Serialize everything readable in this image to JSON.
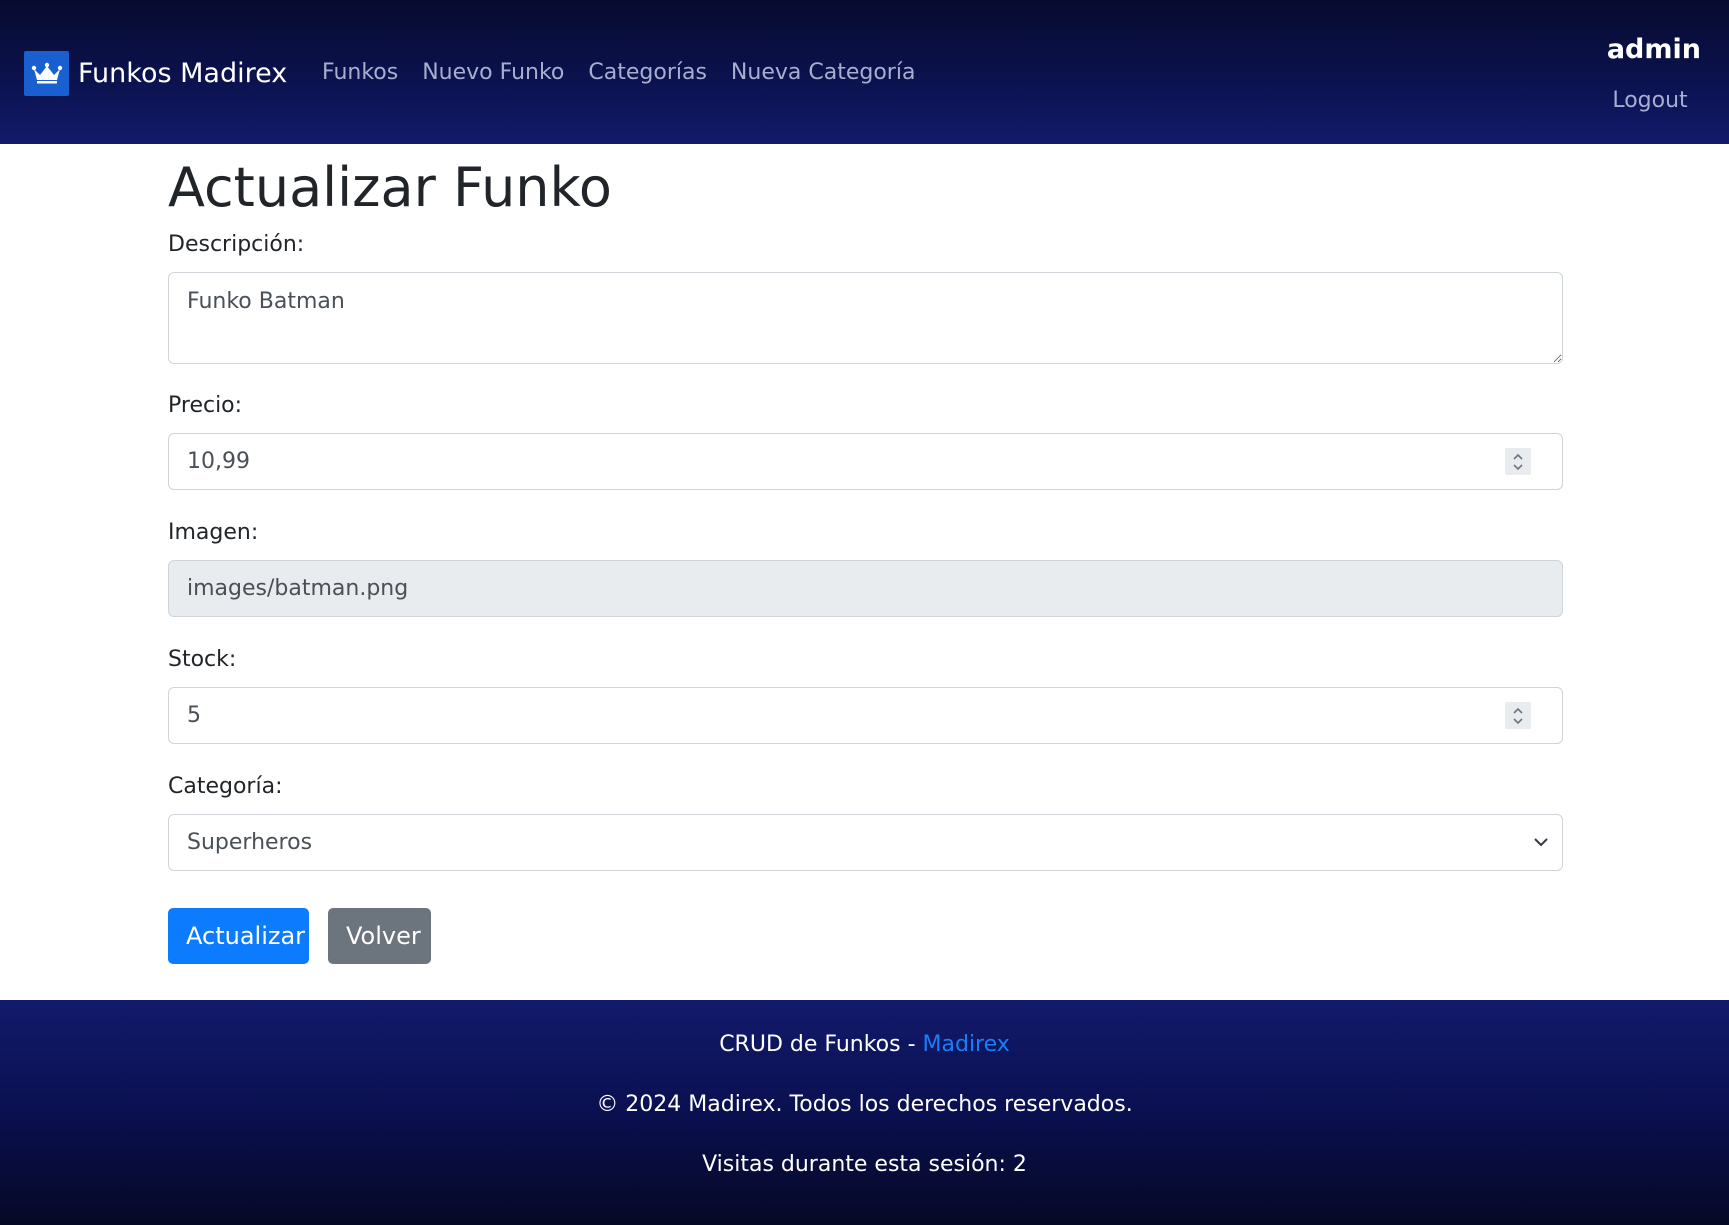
{
  "navbar": {
    "brand": "Funkos Madirex",
    "links": [
      "Funkos",
      "Nuevo Funko",
      "Categorías",
      "Nueva Categoría"
    ],
    "username": "admin",
    "logout": "Logout"
  },
  "form": {
    "title": "Actualizar Funko",
    "descripcion": {
      "label": "Descripción:",
      "value": "Funko Batman"
    },
    "precio": {
      "label": "Precio:",
      "value": "10,99"
    },
    "imagen": {
      "label": "Imagen:",
      "value": "images/batman.png"
    },
    "stock": {
      "label": "Stock:",
      "value": "5"
    },
    "categoria": {
      "label": "Categoría:",
      "selected": "Superheros"
    },
    "submit_label": "Actualizar",
    "back_label": "Volver"
  },
  "footer": {
    "crud_prefix": "CRUD de Funkos - ",
    "crud_link": "Madirex",
    "copyright": "© 2024 Madirex. Todos los derechos reservados.",
    "visits": "Visitas durante esta sesión: 2"
  },
  "colors": {
    "navbar": "#0b124e",
    "primary": "#0d7bfd",
    "secondary": "#6c757d",
    "link": "#1a7dfa"
  },
  "icons": {
    "brand": "crown-icon",
    "spinner": "stepper-icon",
    "select": "chevron-down-icon",
    "textarea": "resize-handle-icon"
  }
}
